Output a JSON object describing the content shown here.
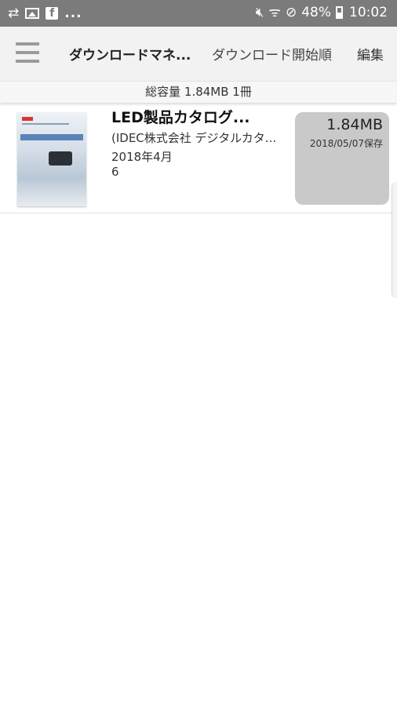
{
  "status_bar": {
    "left_icons": [
      "sync-icon",
      "image-icon",
      "facebook-icon"
    ],
    "more": "...",
    "right_icons": [
      "mute-icon",
      "wifi-icon",
      "dnd-icon",
      "battery-icon"
    ],
    "battery": "48%",
    "time": "10:02"
  },
  "app_bar": {
    "title": "ダウンロードマネ...",
    "sort_label": "ダウンロード開始順",
    "edit_label": "編集"
  },
  "summary": {
    "text": "総容量 1.84MB 1冊"
  },
  "items": [
    {
      "title": "LED製品カタログ...",
      "publisher": "(IDEC株式会社 デジタルカタ...",
      "date": "2018年4月",
      "volume": "6",
      "size": "1.84MB",
      "saved": "2018/05/07保存"
    }
  ]
}
